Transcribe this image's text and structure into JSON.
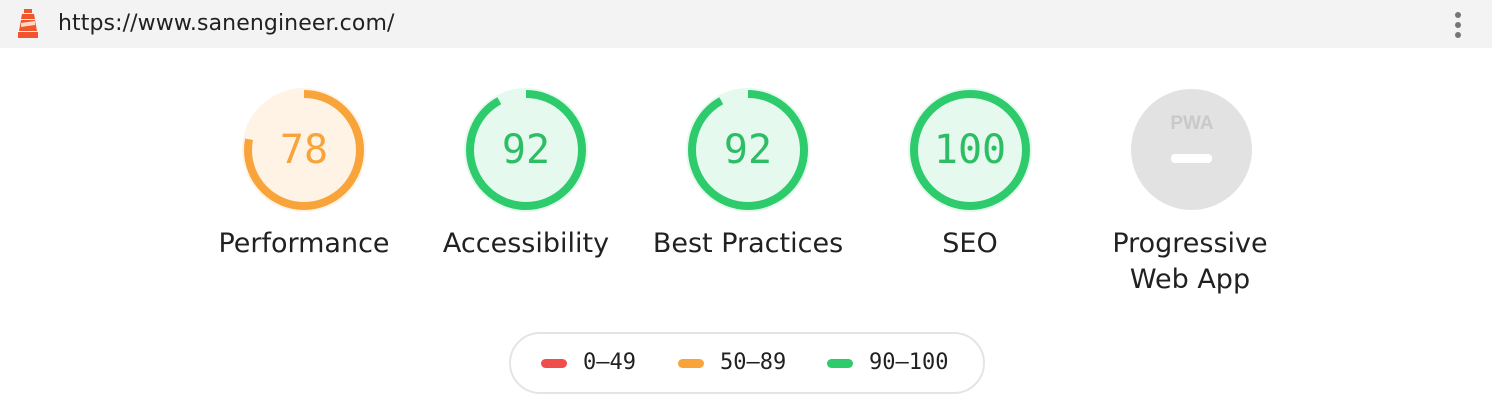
{
  "header": {
    "url": "https://www.sanengineer.com/"
  },
  "colors": {
    "fail": "#f04d4d",
    "average": "#f8a43a",
    "pass": "#2dcb6b",
    "na": "#e2e2e2"
  },
  "gauges": [
    {
      "label": "Performance",
      "score": "78",
      "value": 78,
      "rating": "average"
    },
    {
      "label": "Accessibility",
      "score": "92",
      "value": 92,
      "rating": "pass"
    },
    {
      "label": "Best Practices",
      "score": "92",
      "value": 92,
      "rating": "pass"
    },
    {
      "label": "SEO",
      "score": "100",
      "value": 100,
      "rating": "pass"
    }
  ],
  "pwa": {
    "badge": "PWA",
    "label_line1": "Progressive",
    "label_line2": "Web App"
  },
  "legend": [
    {
      "range": "0–49",
      "rating": "fail"
    },
    {
      "range": "50–89",
      "rating": "average"
    },
    {
      "range": "90–100",
      "rating": "pass"
    }
  ]
}
